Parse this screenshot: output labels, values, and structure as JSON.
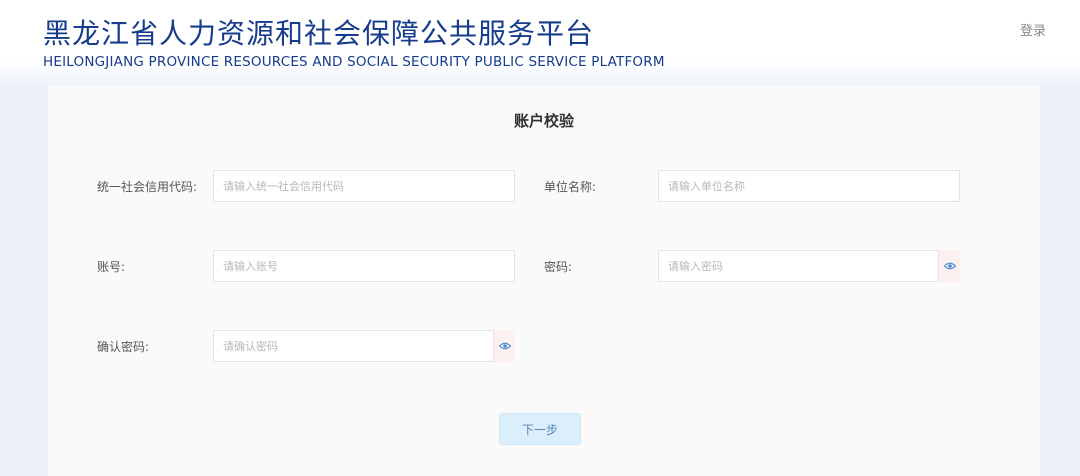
{
  "header": {
    "title_cn": "黑龙江省人力资源和社会保障公共服务平台",
    "title_en": "HEILONGJIANG PROVINCE RESOURCES AND SOCIAL SECURITY PUBLIC SERVICE PLATFORM",
    "login_label": "登录"
  },
  "form": {
    "title": "账户校验",
    "credit_code": {
      "label": "统一社会信用代码:",
      "placeholder": "请输入统一社会信用代码",
      "value": ""
    },
    "company_name": {
      "label": "单位名称:",
      "placeholder": "请输入单位名称",
      "value": ""
    },
    "account": {
      "label": "账号:",
      "placeholder": "请输入账号",
      "value": ""
    },
    "password": {
      "label": "密码:",
      "placeholder": "请输入密码",
      "value": ""
    },
    "confirm_password": {
      "label": "确认密码:",
      "placeholder": "请确认密码",
      "value": ""
    },
    "next_label": "下一步"
  },
  "colors": {
    "brand": "#173c8c",
    "eye_icon": "#4a90d9",
    "button_bg": "#dbeefb",
    "button_text": "#5a83b4"
  },
  "icons": {
    "password_toggle": "eye-icon",
    "confirm_password_toggle": "eye-icon"
  }
}
